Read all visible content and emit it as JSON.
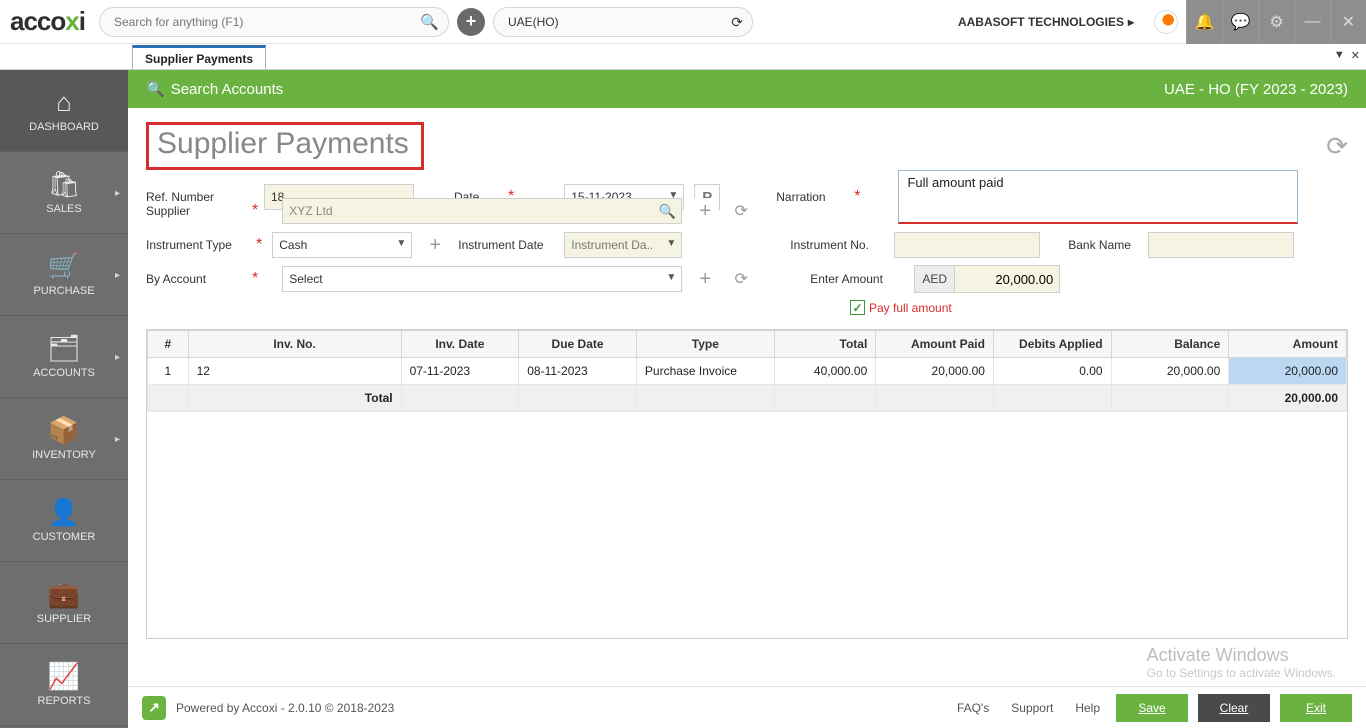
{
  "top": {
    "logo_a": "acco",
    "logo_b": "x",
    "logo_c": "i",
    "search_placeholder": "Search for anything (F1)",
    "org": "UAE(HO)",
    "company": "AABASOFT TECHNOLOGIES"
  },
  "tab": {
    "title": "Supplier Payments"
  },
  "sidebar": {
    "items": [
      {
        "icon": "⌂",
        "label": "DASHBOARD"
      },
      {
        "icon": "🛍",
        "label": "SALES"
      },
      {
        "icon": "🛒",
        "label": "PURCHASE"
      },
      {
        "icon": "🗂",
        "label": "ACCOUNTS"
      },
      {
        "icon": "📦",
        "label": "INVENTORY"
      },
      {
        "icon": "👤",
        "label": "CUSTOMER"
      },
      {
        "icon": "💼",
        "label": "SUPPLIER"
      },
      {
        "icon": "📈",
        "label": "REPORTS"
      }
    ]
  },
  "green": {
    "search": "Search Accounts",
    "context": "UAE - HO (FY 2023 - 2023)"
  },
  "page": {
    "title": "Supplier Payments"
  },
  "form": {
    "ref_label": "Ref. Number",
    "ref_value": "18",
    "date_label": "Date",
    "date_value": "15-11-2023",
    "supplier_label": "Supplier",
    "supplier_value": "XYZ Ltd",
    "instr_type_label": "Instrument Type",
    "instr_type_value": "Cash",
    "instr_date_label": "Instrument Date",
    "instr_date_placeholder": "Instrument Da..",
    "by_account_label": "By Account",
    "by_account_value": "Select",
    "narration_label": "Narration",
    "narration_value": "Full amount paid",
    "instr_no_label": "Instrument No.",
    "bank_label": "Bank Name",
    "amount_label": "Enter Amount",
    "currency": "AED",
    "amount_value": "20,000.00",
    "pay_full_label": "Pay full amount"
  },
  "table": {
    "headers": [
      "#",
      "Inv. No.",
      "Inv. Date",
      "Due Date",
      "Type",
      "Total",
      "Amount Paid",
      "Debits Applied",
      "Balance",
      "Amount"
    ],
    "rows": [
      {
        "n": "1",
        "inv": "12",
        "inv_date": "07-11-2023",
        "due": "08-11-2023",
        "type": "Purchase Invoice",
        "total": "40,000.00",
        "paid": "20,000.00",
        "debits": "0.00",
        "balance": "20,000.00",
        "amount": "20,000.00"
      }
    ],
    "total_label": "Total",
    "total_amount": "20,000.00"
  },
  "footer": {
    "powered": "Powered by Accoxi - 2.0.10 © 2018-2023",
    "faq": "FAQ's",
    "support": "Support",
    "help": "Help",
    "save": "Save",
    "clear": "Clear",
    "exit": "Exit"
  },
  "wm": {
    "l1": "Activate Windows",
    "l2": "Go to Settings to activate Windows."
  }
}
